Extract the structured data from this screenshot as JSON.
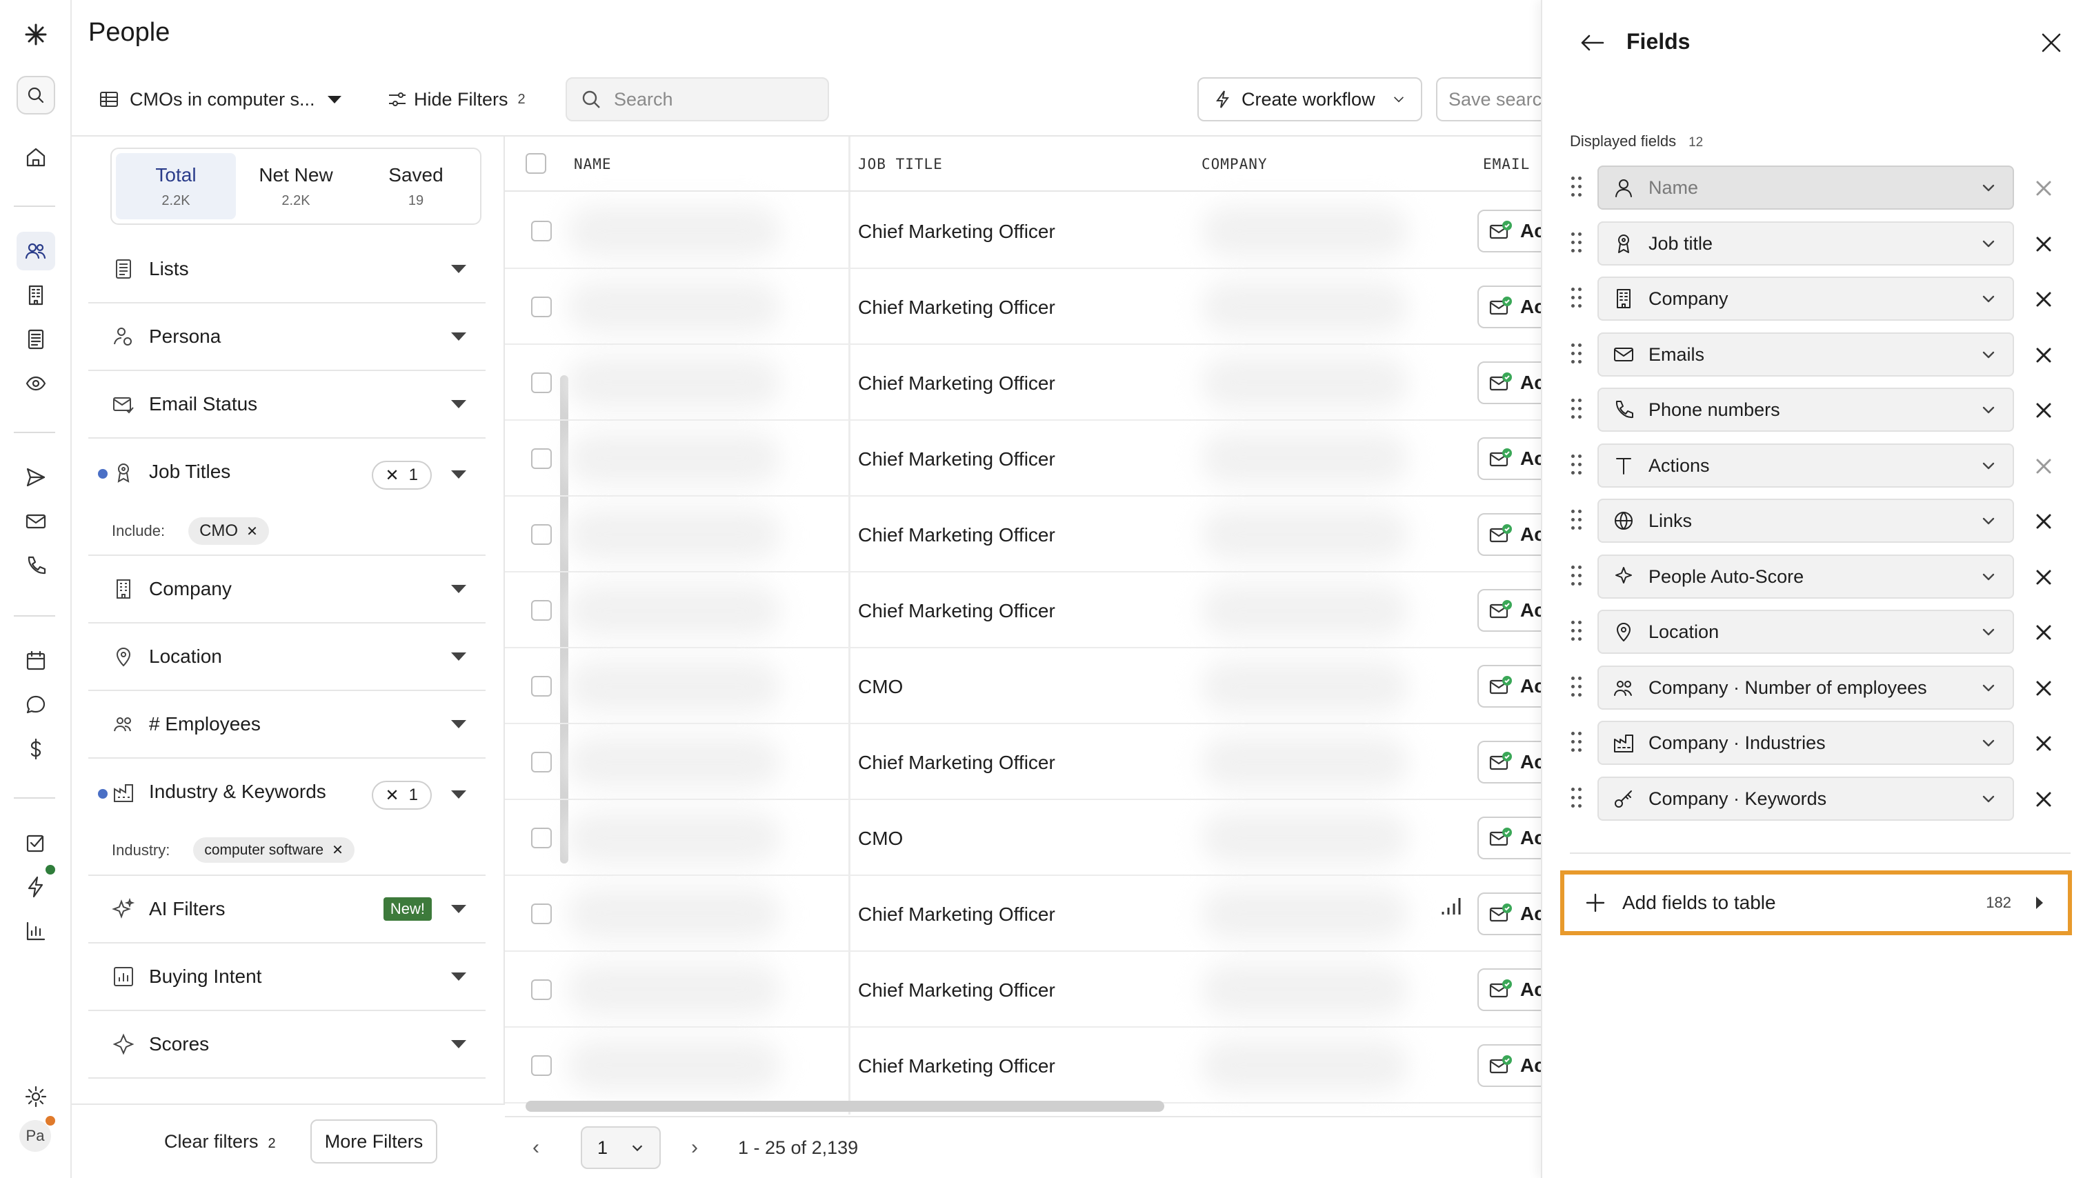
{
  "page": {
    "title": "People"
  },
  "toolbar": {
    "list_name": "CMOs in computer s...",
    "hide_filters": "Hide Filters",
    "hide_filters_count": "2",
    "search_placeholder": "Search",
    "create_workflow": "Create workflow",
    "save_search": "Save searc"
  },
  "segments": [
    {
      "label": "Total",
      "count": "2.2K"
    },
    {
      "label": "Net New",
      "count": "2.2K"
    },
    {
      "label": "Saved",
      "count": "19"
    }
  ],
  "filters": {
    "lists": "Lists",
    "persona": "Persona",
    "email_status": "Email Status",
    "job_titles": "Job Titles",
    "job_titles_count": "1",
    "include_label": "Include:",
    "include_value": "CMO",
    "company": "Company",
    "location": "Location",
    "employees": "# Employees",
    "industry": "Industry & Keywords",
    "industry_count": "1",
    "industry_label": "Industry:",
    "industry_value": "computer software",
    "ai_filters": "AI Filters",
    "new_badge": "New!",
    "buying_intent": "Buying Intent",
    "scores": "Scores",
    "clear_filters": "Clear filters",
    "clear_count": "2",
    "more_filters": "More Filters"
  },
  "table": {
    "headers": {
      "name": "NAME",
      "job_title": "JOB TITLE",
      "company": "COMPANY",
      "email": "EMAIL"
    },
    "rows": [
      {
        "job_title": "Chief Marketing Officer"
      },
      {
        "job_title": "Chief Marketing Officer"
      },
      {
        "job_title": "Chief Marketing Officer"
      },
      {
        "job_title": "Chief Marketing Officer"
      },
      {
        "job_title": "Chief Marketing Officer"
      },
      {
        "job_title": "Chief Marketing Officer"
      },
      {
        "job_title": "CMO"
      },
      {
        "job_title": "Chief Marketing Officer"
      },
      {
        "job_title": "CMO"
      },
      {
        "job_title": "Chief Marketing Officer"
      },
      {
        "job_title": "Chief Marketing Officer"
      },
      {
        "job_title": "Chief Marketing Officer"
      }
    ],
    "email_btn_text": "Ac"
  },
  "pager": {
    "page": "1",
    "range": "1 - 25 of 2,139"
  },
  "fields_panel": {
    "title": "Fields",
    "displayed_label": "Displayed fields",
    "displayed_count": "12",
    "items": [
      {
        "label": "Name",
        "icon": "user-icon"
      },
      {
        "label": "Job title",
        "icon": "badge-icon"
      },
      {
        "label": "Company",
        "icon": "building-icon"
      },
      {
        "label": "Emails",
        "icon": "mail-icon"
      },
      {
        "label": "Phone numbers",
        "icon": "phone-icon"
      },
      {
        "label": "Actions",
        "icon": "text-icon"
      },
      {
        "label": "Links",
        "icon": "globe-icon"
      },
      {
        "label": "People Auto-Score",
        "icon": "sparkle-icon"
      },
      {
        "label": "Location",
        "icon": "pin-icon"
      },
      {
        "label": "Company · Number of employees",
        "icon": "people-icon"
      },
      {
        "label": "Company · Industries",
        "icon": "factory-icon"
      },
      {
        "label": "Company · Keywords",
        "icon": "key-icon"
      }
    ],
    "add_fields": "Add fields to table",
    "add_fields_count": "182"
  },
  "user": {
    "initials": "Pa"
  }
}
